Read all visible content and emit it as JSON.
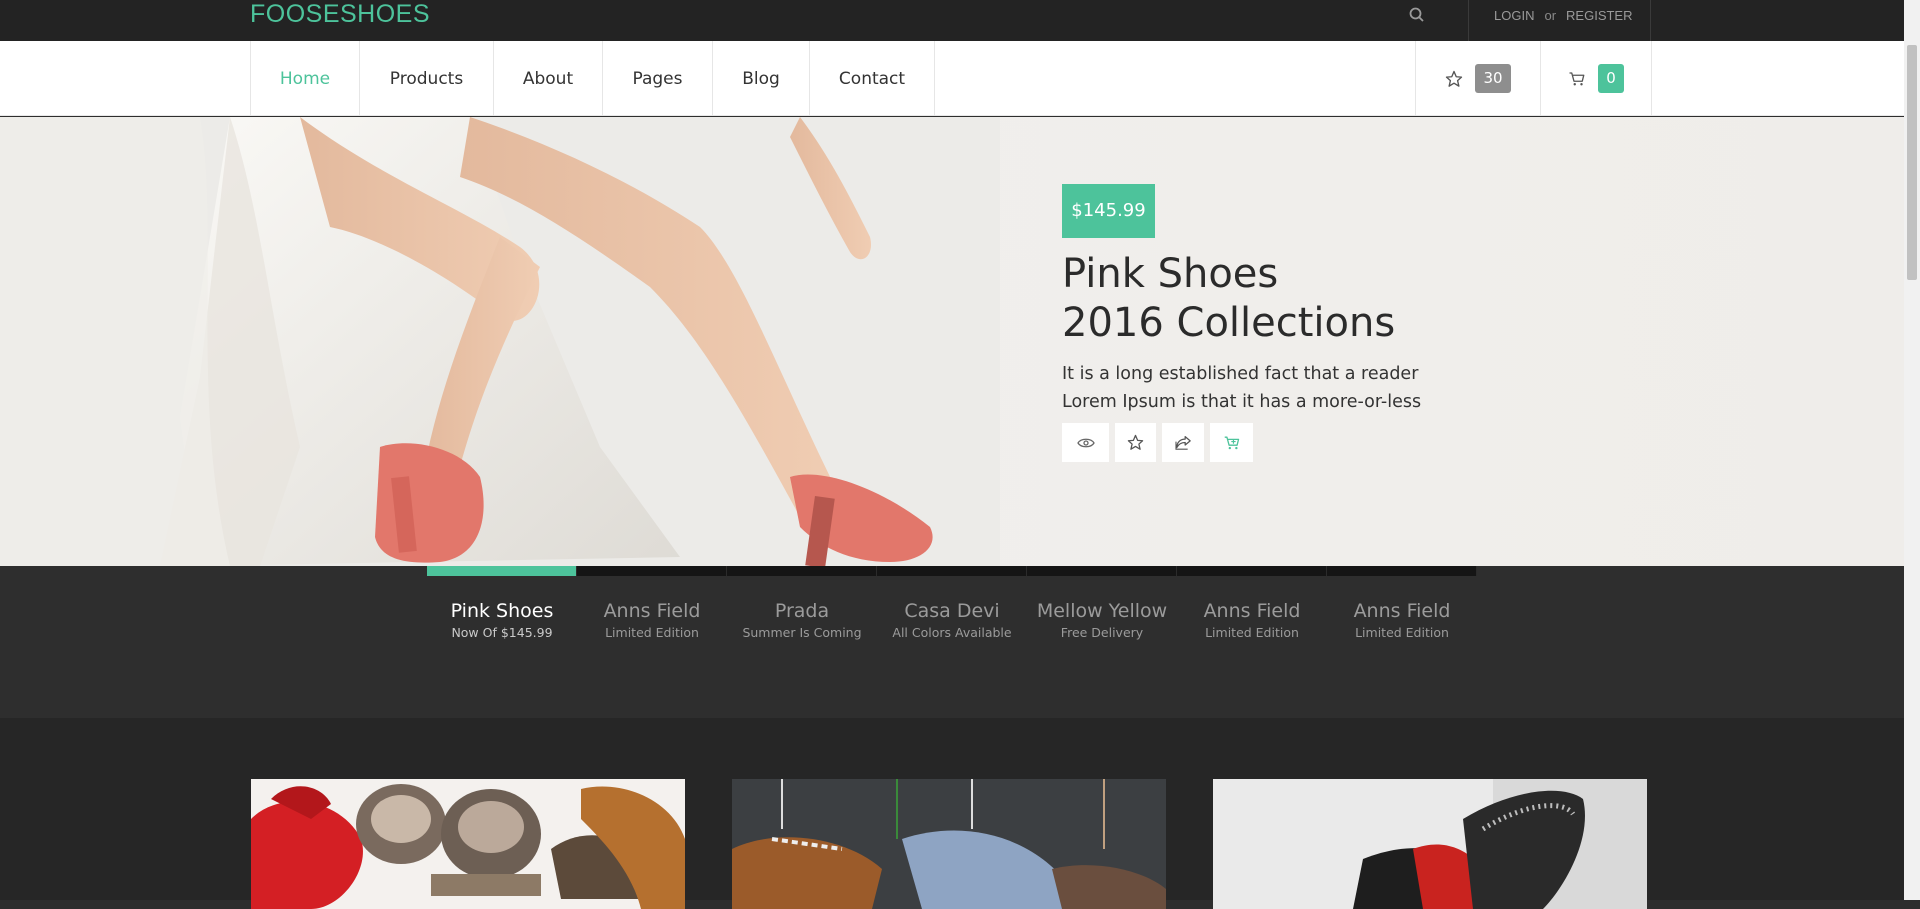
{
  "brand": {
    "logo": "FOOSESHOES",
    "accent": "#4dc39b"
  },
  "topbar": {
    "login": "LOGIN",
    "or": "or",
    "register": "REGISTER"
  },
  "nav": {
    "items": [
      "Home",
      "Products",
      "About",
      "Pages",
      "Blog",
      "Contact"
    ],
    "active": "Home",
    "wishlist_count": "30",
    "cart_count": "0"
  },
  "hero": {
    "price": "$145.99",
    "title_line1": "Pink Shoes",
    "title_line2": "2016 Collections",
    "desc_line1": "It is a long established fact that a reader",
    "desc_line2": "Lorem Ipsum is that it has a more-or-less",
    "actions": [
      "eye-icon",
      "star-icon",
      "share-icon",
      "cart-add-icon"
    ]
  },
  "slider_tabs": [
    {
      "title": "Pink Shoes",
      "subtitle": "Now Of $145.99"
    },
    {
      "title": "Anns Field",
      "subtitle": "Limited Edition"
    },
    {
      "title": "Prada",
      "subtitle": "Summer Is Coming"
    },
    {
      "title": "Casa Devi",
      "subtitle": "All Colors Available"
    },
    {
      "title": "Mellow Yellow",
      "subtitle": "Free Delivery"
    },
    {
      "title": "Anns Field",
      "subtitle": "Limited Edition"
    },
    {
      "title": "Anns Field",
      "subtitle": "Limited Edition"
    }
  ]
}
